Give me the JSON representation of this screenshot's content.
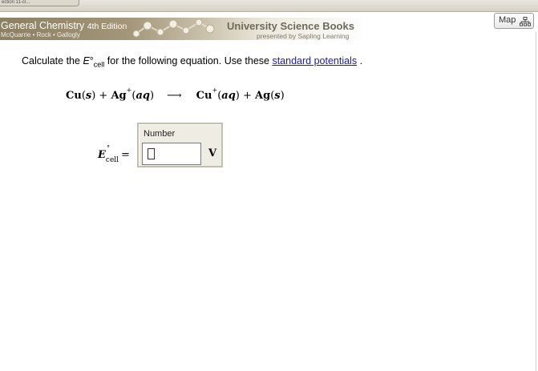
{
  "top_bar": {
    "tab_text": "ection 11-cl..."
  },
  "header": {
    "book_title": "General Chemistry",
    "edition": "4th Edition",
    "authors": "McQuarrie • Rock • Gallogly",
    "publisher": "University Science Books",
    "presenter": "presented by Sapling Learning",
    "map_button": "Map",
    "map_icon": "sitemap-icon"
  },
  "question": {
    "prefix": "Calculate the ",
    "symbol_E": "E",
    "symbol_deg": "°",
    "symbol_sub": "cell",
    "middle": " for the following equation. Use these ",
    "link_text": "standard potentials",
    "suffix": " ."
  },
  "equation": {
    "reactant1": "Cu",
    "reactant1_state": "s",
    "plus1": " + ",
    "reactant2": "Ag",
    "reactant2_charge": "+",
    "reactant2_state": "aq",
    "arrow": "⟶",
    "product1": "Cu",
    "product1_charge": "+",
    "product1_state": "aq",
    "plus2": " + ",
    "product2": "Ag",
    "product2_state": "s"
  },
  "answer": {
    "label_E": "E",
    "label_deg": "°",
    "label_sub": "cell",
    "equals": "=",
    "field_label": "Number",
    "value": "",
    "unit": "V"
  }
}
